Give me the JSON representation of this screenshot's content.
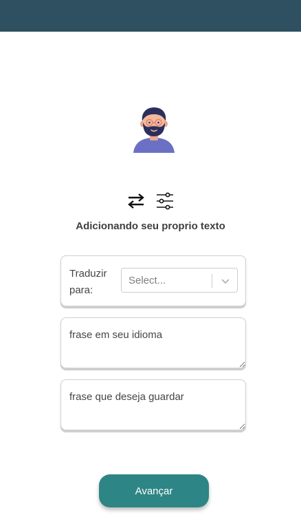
{
  "colors": {
    "header": "#2e5060",
    "accent": "#2e8585",
    "avatar_shirt": "#6c70c4",
    "avatar_hair": "#2b2f5e"
  },
  "toolbar": {
    "swap_icon": "swap-arrows-icon",
    "settings_icon": "sliders-icon"
  },
  "main": {
    "heading": "Adicionando seu proprio texto"
  },
  "translate": {
    "label": "Traduzir para:",
    "select_placeholder": "Select..."
  },
  "native_phrase": {
    "placeholder": "frase em seu idioma"
  },
  "save_phrase": {
    "placeholder": "frase que deseja guardar"
  },
  "actions": {
    "next_label": "Avançar"
  }
}
